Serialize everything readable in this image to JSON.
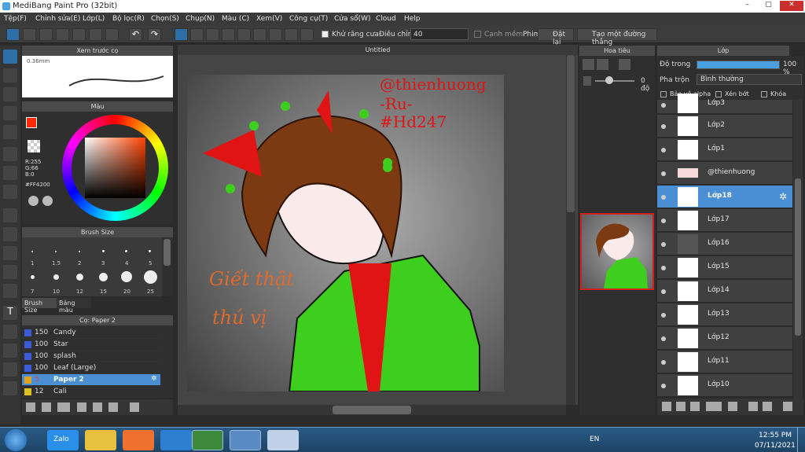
{
  "window": {
    "title": "MediBang Paint Pro (32bit)"
  },
  "menu": [
    "Tệp(F)",
    "Chỉnh sửa(E)",
    "Lớp(L)",
    "Bộ lọc(R)",
    "Chọn(S)",
    "Chụp(N)",
    "Màu (C)",
    "Xem(V)",
    "Công cụ(T)",
    "Cửa sổ(W)",
    "Cloud",
    "Help"
  ],
  "toolbar": {
    "antialias": "Khử răng cưa",
    "adjust_label": "Điều chỉnh",
    "adjust_value": "40",
    "cloudedge": "Cạnh mềm",
    "phim": "Phim",
    "reset": "Đặt lại",
    "straight": "Tạo một đường thẳng"
  },
  "brush_preview": {
    "title": "Xem trước cọ",
    "size": "0.36mm"
  },
  "color": {
    "title": "Màu",
    "r": "R:255",
    "g": "G:66",
    "b": "B:0",
    "hex": "#FF4200",
    "primary": "#ff2a00",
    "secondary": "#3aa8e8"
  },
  "brush_size": {
    "title": "Brush Size",
    "row1": [
      "1",
      "1.5",
      "2",
      "3",
      "4",
      "5"
    ],
    "row2": [
      "7",
      "10",
      "12",
      "15",
      "20",
      "25"
    ],
    "tab1": "Brush Size",
    "tab2": "Bảng màu"
  },
  "brush_list": {
    "title": "Cọ: Paper 2",
    "items": [
      {
        "size": "150",
        "name": "Candy",
        "color": "#3b5bd8"
      },
      {
        "size": "100",
        "name": "Star",
        "color": "#3b5bd8"
      },
      {
        "size": "100",
        "name": "splash",
        "color": "#3b5bd8"
      },
      {
        "size": "100",
        "name": "Leaf (Large)",
        "color": "#3b5bd8"
      },
      {
        "size": "5",
        "name": "Paper 2",
        "color": "#e0a020",
        "selected": true
      },
      {
        "size": "12",
        "name": "Cali",
        "color": "#e0c020"
      }
    ]
  },
  "canvas": {
    "tab": "Untitled",
    "watermark1": "@thienhuong",
    "watermark2": "-Ru-",
    "watermark3": "#Hd247",
    "note1": "Giết thật",
    "note2": "thú vị"
  },
  "navigator": {
    "title": "Hoa tiêu",
    "angle": "0 độ"
  },
  "layers": {
    "title": "Lớp",
    "opacity_label": "Độ trong",
    "opacity_value": "100 %",
    "blend_label": "Pha trộn",
    "blend_value": "Bình thường",
    "protect_alpha": "Bảo vệ alpha",
    "clip": "Xén bớt",
    "lock": "Khóa",
    "items": [
      {
        "name": "Lớp3"
      },
      {
        "name": "Lớp2"
      },
      {
        "name": "Lớp1"
      },
      {
        "name": "@thienhuong"
      },
      {
        "name": "Lớp18",
        "selected": true
      },
      {
        "name": "Lớp17"
      },
      {
        "name": "Lớp16"
      },
      {
        "name": "Lớp15"
      },
      {
        "name": "Lớp14"
      },
      {
        "name": "Lớp13"
      },
      {
        "name": "Lớp12"
      },
      {
        "name": "Lớp11"
      },
      {
        "name": "Lớp10"
      }
    ]
  },
  "taskbar": {
    "lang": "EN",
    "time": "12:55 PM",
    "date": "07/11/2021",
    "zalo": "Zalo"
  }
}
